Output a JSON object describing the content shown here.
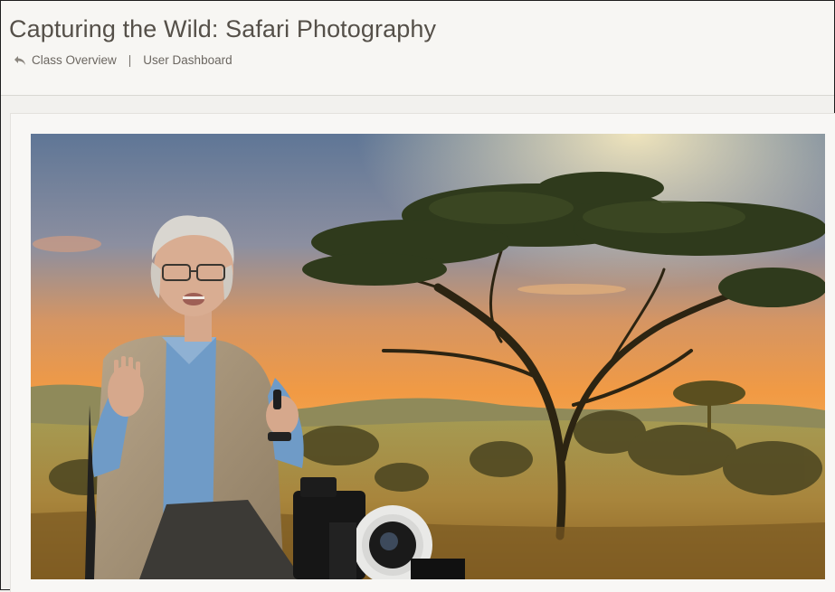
{
  "header": {
    "title": "Capturing the Wild: Safari Photography",
    "breadcrumb": {
      "back_icon": "reply-arrow-icon",
      "class_overview": "Class Overview",
      "separator": "|",
      "user_dashboard": "User Dashboard"
    }
  },
  "video": {
    "scene": "instructor-on-savanna-backdrop"
  },
  "colors": {
    "header_bg": "#f7f6f3",
    "title": "#555049",
    "link": "#6b6660",
    "sky_top": "#6f86a6",
    "sky_glow": "#f4a24a"
  }
}
